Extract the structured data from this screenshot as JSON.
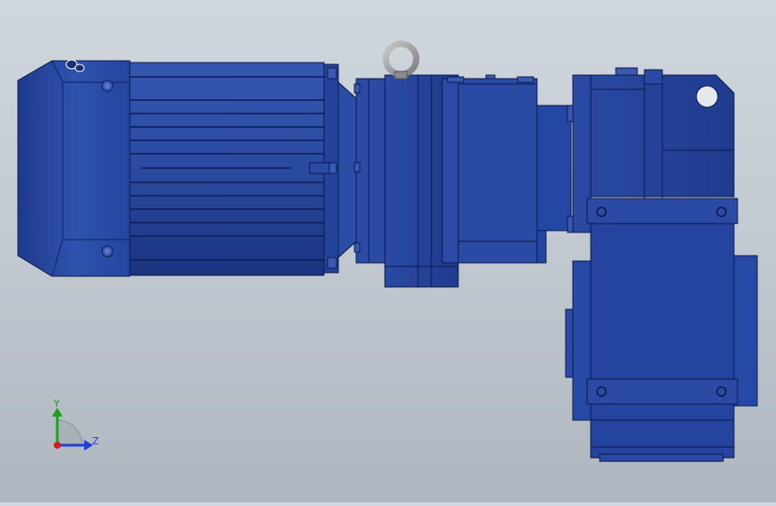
{
  "scene": {
    "description_type": "cad-3d-model-viewport",
    "model_color": "#23408f",
    "background_top": "#cfd6de",
    "background_bottom": "#aeb6bf",
    "eyebolt_color": "#9a9a9a"
  },
  "triad": {
    "y_label": "Y",
    "z_label": "Z",
    "y_color": "#1aa31a",
    "z_color": "#1f3fd6",
    "origin_color": "#d42020"
  }
}
